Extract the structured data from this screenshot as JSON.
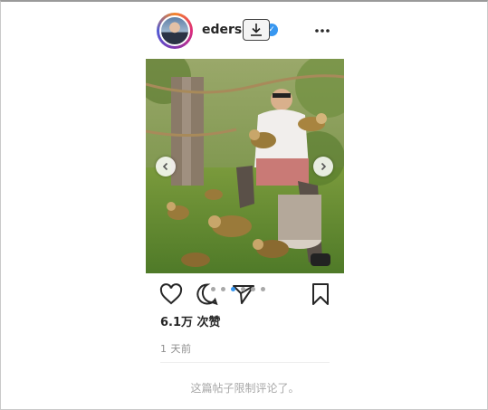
{
  "post": {
    "username": "edersor",
    "verified_symbol": "✓",
    "avatar_icon": "profile-avatar",
    "likes_label": "6.1万 次赞",
    "time_ago": "1 天前",
    "comments_limited": "这篇帖子限制评论了。",
    "carousel": {
      "total_slides": 6,
      "active_index": 2
    }
  },
  "icons": {
    "download": "download-icon",
    "more": "more-options-icon",
    "like": "heart-icon",
    "comment": "comment-icon",
    "share": "share-icon",
    "save": "bookmark-icon",
    "prev": "chevron-left-icon",
    "next": "chevron-right-icon"
  },
  "colors": {
    "verified": "#3897f0",
    "active_dot": "#3897f0",
    "text": "#262626",
    "muted": "#8e8e8e"
  }
}
